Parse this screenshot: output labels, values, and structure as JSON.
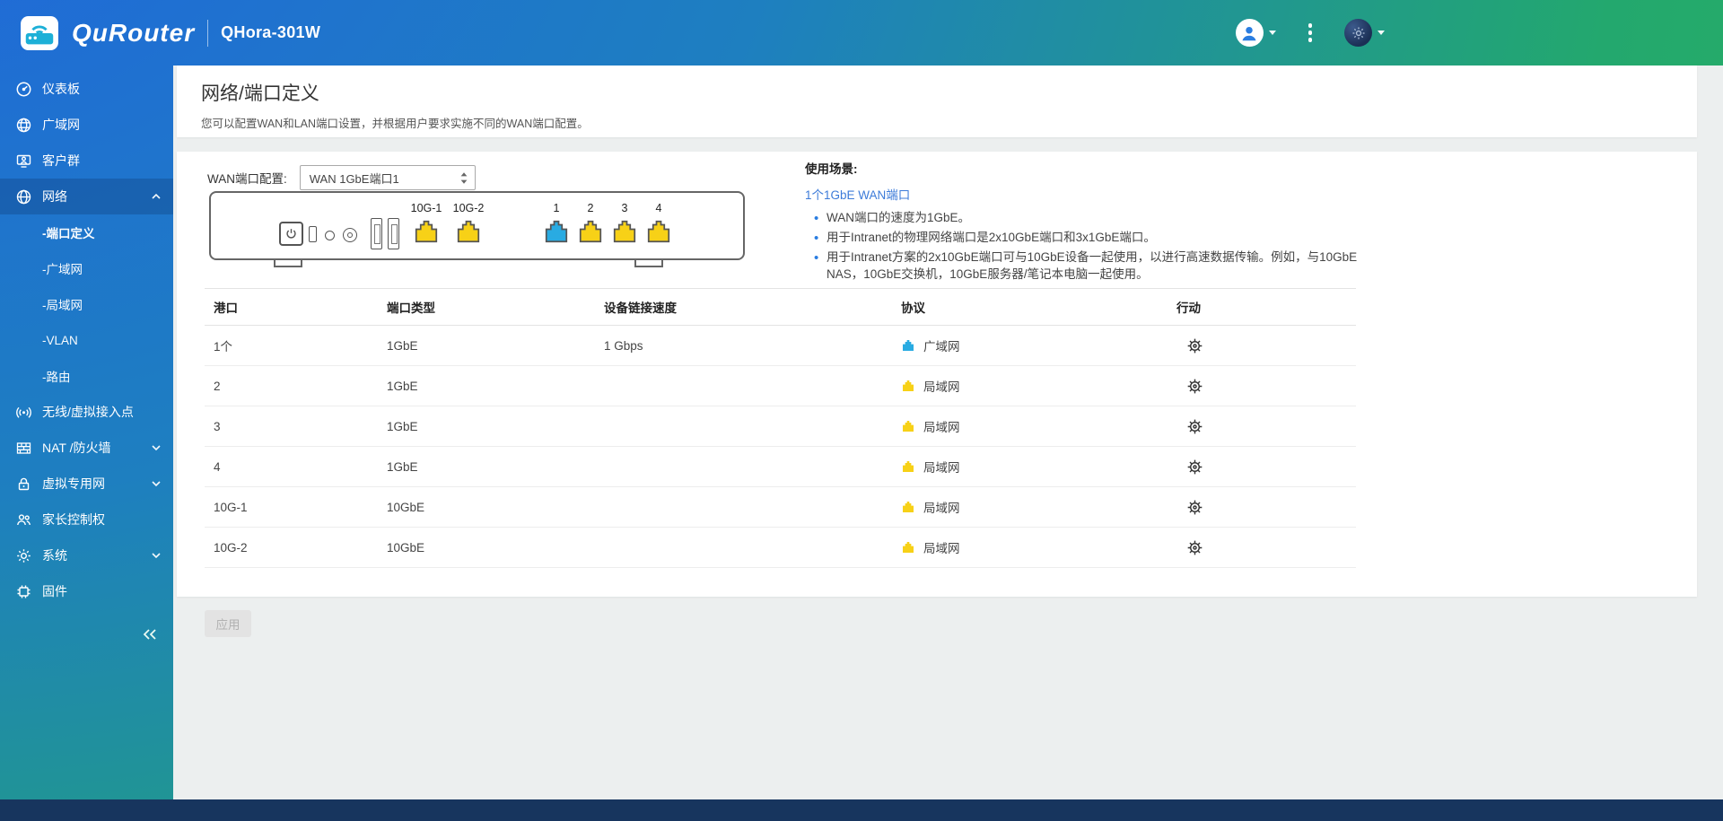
{
  "header": {
    "brand": "QuRouter",
    "device": "QHora-301W"
  },
  "sidebar": {
    "items": [
      {
        "label": "仪表板"
      },
      {
        "label": "广域网"
      },
      {
        "label": "客户群"
      },
      {
        "label": "网络",
        "expanded": true,
        "active": true
      },
      {
        "label": "无线/虚拟接入点"
      },
      {
        "label": "NAT /防火墙",
        "collapsible": true
      },
      {
        "label": "虚拟专用网",
        "collapsible": true
      },
      {
        "label": "家长控制权"
      },
      {
        "label": "系统",
        "collapsible": true
      },
      {
        "label": "固件"
      }
    ],
    "network_children": [
      {
        "label": "-端口定义",
        "selected": true
      },
      {
        "label": "-广域网"
      },
      {
        "label": "-局域网"
      },
      {
        "label": "-VLAN"
      },
      {
        "label": "-路由"
      }
    ]
  },
  "page": {
    "title": "网络/端口定义",
    "description": "您可以配置WAN和LAN端口设置，并根据用户要求实施不同的WAN端口配置。"
  },
  "wan_config": {
    "label": "WAN端口配置:",
    "selected_option": "WAN 1GbE端口1"
  },
  "diagram": {
    "labels": {
      "p10g1": "10G-1",
      "p10g2": "10G-2",
      "p1": "1",
      "p2": "2",
      "p3": "3",
      "p4": "4"
    }
  },
  "usage": {
    "title": "使用场景:",
    "subtitle": "1个1GbE WAN端口",
    "bullets": [
      "WAN端口的速度为1GbE。",
      "用于Intranet的物理网络端口是2x10GbE端口和3x1GbE端口。",
      "用于Intranet方案的2x10GbE端口可与10GbE设备一起使用，以进行高速数据传输。例如，与10GbE NAS，10GbE交换机，10GbE服务器/笔记本电脑一起使用。"
    ]
  },
  "table": {
    "headers": [
      "港口",
      "端口类型",
      "设备链接速度",
      "协议",
      "行动"
    ],
    "rows": [
      {
        "port": "1个",
        "type": "1GbE",
        "speed": "1 Gbps",
        "protocol": "广域网",
        "kind": "wan"
      },
      {
        "port": "2",
        "type": "1GbE",
        "speed": "",
        "protocol": "局域网",
        "kind": "lan"
      },
      {
        "port": "3",
        "type": "1GbE",
        "speed": "",
        "protocol": "局域网",
        "kind": "lan"
      },
      {
        "port": "4",
        "type": "1GbE",
        "speed": "",
        "protocol": "局域网",
        "kind": "lan"
      },
      {
        "port": "10G-1",
        "type": "10GbE",
        "speed": "",
        "protocol": "局域网",
        "kind": "lan"
      },
      {
        "port": "10G-2",
        "type": "10GbE",
        "speed": "",
        "protocol": "局域网",
        "kind": "lan"
      }
    ]
  },
  "footer": {
    "apply_label": "应用"
  },
  "colors": {
    "wan_port": "#29abe2",
    "lan_port": "#f7d117",
    "accent_blue": "#2a7de1",
    "header_gradient_start": "#2066dd",
    "header_gradient_end": "#2db55c",
    "bottom_bar": "#17355e"
  }
}
